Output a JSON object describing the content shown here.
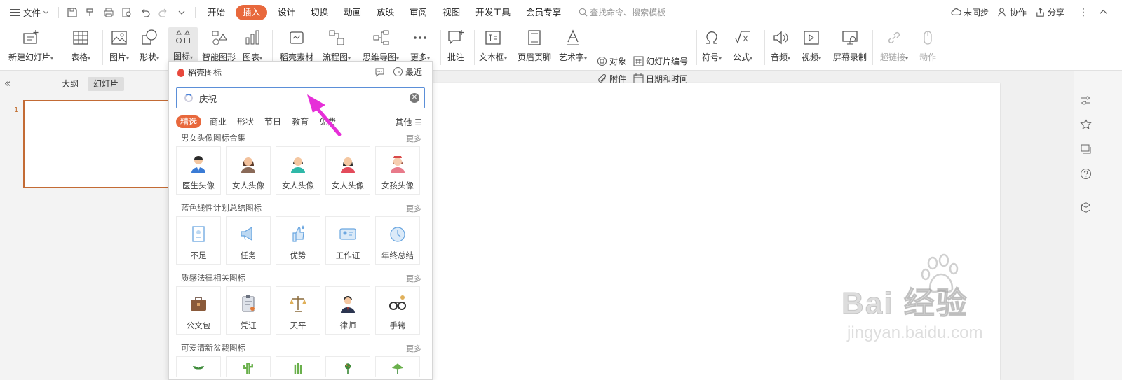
{
  "menu": {
    "file_label": "文件"
  },
  "tabs": [
    {
      "label": "开始"
    },
    {
      "label": "插入"
    },
    {
      "label": "设计"
    },
    {
      "label": "切换"
    },
    {
      "label": "动画"
    },
    {
      "label": "放映"
    },
    {
      "label": "审阅"
    },
    {
      "label": "视图"
    },
    {
      "label": "开发工具"
    },
    {
      "label": "会员专享"
    }
  ],
  "search_placeholder": "查找命令、搜索模板",
  "top_right": {
    "sync": "未同步",
    "collab": "协作",
    "share": "分享"
  },
  "ribbon": {
    "new_slide": "新建幻灯片",
    "table": "表格",
    "picture": "图片",
    "shape": "形状",
    "icon": "图标",
    "smartart": "智能图形",
    "chart": "图表",
    "material": "稻壳素材",
    "flowchart": "流程图",
    "mindmap": "思维导图",
    "more": "更多",
    "comment": "批注",
    "textbox": "文本框",
    "header_footer": "页眉页脚",
    "wordart": "艺术字",
    "object": "对象",
    "attachment": "附件",
    "slide_number": "幻灯片编号",
    "datetime": "日期和时间",
    "symbol": "符号",
    "formula": "公式",
    "audio": "音频",
    "video": "视频",
    "screen_record": "屏幕录制",
    "hyperlink": "超链接",
    "action": "动作"
  },
  "view_tabs": {
    "outline": "大纲",
    "slides": "幻灯片"
  },
  "slide_number": "1",
  "panel": {
    "title": "稻壳图标",
    "recent": "最近",
    "search_value": "庆祝",
    "categories": [
      "精选",
      "商业",
      "形状",
      "节日",
      "教育",
      "免费"
    ],
    "other": "其他",
    "more_label": "更多",
    "sections": [
      {
        "title": "男女头像图标合集",
        "items": [
          "医生头像",
          "女人头像",
          "女人头像",
          "女人头像",
          "女孩头像"
        ]
      },
      {
        "title": "蓝色线性计划总结图标",
        "items": [
          "不足",
          "任务",
          "优势",
          "工作证",
          "年终总结"
        ]
      },
      {
        "title": "质感法律相关图标",
        "items": [
          "公文包",
          "凭证",
          "天平",
          "律师",
          "手铐"
        ]
      },
      {
        "title": "可爱清新盆栽图标",
        "items": []
      }
    ]
  },
  "watermark": {
    "main": "Bai 经验",
    "sub": "jingyan.baidu.com"
  },
  "colors": {
    "accent": "#e8683c",
    "arrow": "#e62fd8",
    "search_border": "#5b8fd8"
  }
}
